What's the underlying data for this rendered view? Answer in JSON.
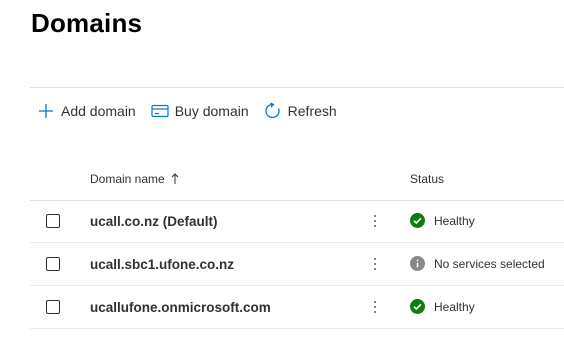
{
  "page": {
    "title": "Domains"
  },
  "toolbar": {
    "add_label": "Add domain",
    "buy_label": "Buy domain",
    "refresh_label": "Refresh"
  },
  "table": {
    "columns": {
      "name": "Domain name",
      "status": "Status"
    },
    "rows": [
      {
        "name": "ucall.co.nz (Default)",
        "status": "Healthy",
        "status_icon": "check-circle-icon",
        "status_color": "#107c10"
      },
      {
        "name": "ucall.sbc1.ufone.co.nz",
        "status": "No services selected",
        "status_icon": "info-circle-icon",
        "status_color": "#8a8886"
      },
      {
        "name": "ucallufone.onmicrosoft.com",
        "status": "Healthy",
        "status_icon": "check-circle-icon",
        "status_color": "#107c10"
      }
    ]
  },
  "colors": {
    "accent": "#0078d4",
    "healthy": "#107c10",
    "info": "#8a8886"
  }
}
